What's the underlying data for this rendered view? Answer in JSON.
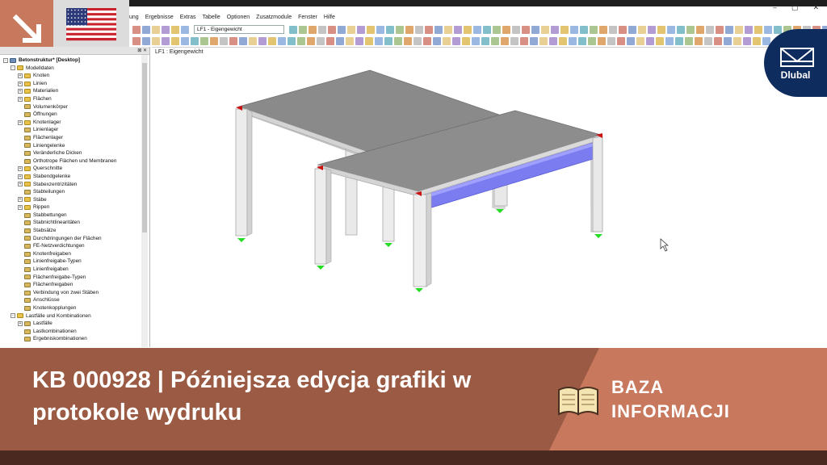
{
  "window": {
    "menu": [
      "ung",
      "Ergebnisse",
      "Extras",
      "Tabelle",
      "Optionen",
      "Zusatzmodule",
      "Fenster",
      "Hilfe"
    ],
    "controls": [
      "–",
      "▢",
      "✕"
    ]
  },
  "toolbar": {
    "loadcase_combo": "LF1 - Eigengewicht"
  },
  "navigator": {
    "root": "Betonstruktur* [Desktop]",
    "items": [
      {
        "label": "Modelldaten",
        "level": 1,
        "expander": "-",
        "icon": "fold"
      },
      {
        "label": "Knoten",
        "level": 2,
        "expander": "+",
        "icon": "fold"
      },
      {
        "label": "Linien",
        "level": 2,
        "expander": "+",
        "icon": "fold"
      },
      {
        "label": "Materialien",
        "level": 2,
        "expander": "+",
        "icon": "fold"
      },
      {
        "label": "Flächen",
        "level": 2,
        "expander": "+",
        "icon": "fold"
      },
      {
        "label": "Volumenkörper",
        "level": 2,
        "expander": "",
        "icon": "item"
      },
      {
        "label": "Öffnungen",
        "level": 2,
        "expander": "",
        "icon": "item"
      },
      {
        "label": "Knotenlager",
        "level": 2,
        "expander": "+",
        "icon": "fold"
      },
      {
        "label": "Linienlager",
        "level": 2,
        "expander": "",
        "icon": "item"
      },
      {
        "label": "Flächenlager",
        "level": 2,
        "expander": "",
        "icon": "item"
      },
      {
        "label": "Liniengelenke",
        "level": 2,
        "expander": "",
        "icon": "item"
      },
      {
        "label": "Veränderliche Dicken",
        "level": 2,
        "expander": "",
        "icon": "item"
      },
      {
        "label": "Orthotrope Flächen und Membranen",
        "level": 2,
        "expander": "",
        "icon": "item"
      },
      {
        "label": "Querschnitte",
        "level": 2,
        "expander": "+",
        "icon": "fold"
      },
      {
        "label": "Stabendgelenke",
        "level": 2,
        "expander": "+",
        "icon": "fold"
      },
      {
        "label": "Stabexzentrizitäten",
        "level": 2,
        "expander": "+",
        "icon": "fold"
      },
      {
        "label": "Stabteilungen",
        "level": 2,
        "expander": "",
        "icon": "item"
      },
      {
        "label": "Stäbe",
        "level": 2,
        "expander": "+",
        "icon": "fold"
      },
      {
        "label": "Rippen",
        "level": 2,
        "expander": "+",
        "icon": "fold"
      },
      {
        "label": "Stabbettungen",
        "level": 2,
        "expander": "",
        "icon": "item"
      },
      {
        "label": "Stabnichtlinearitäten",
        "level": 2,
        "expander": "",
        "icon": "item"
      },
      {
        "label": "Stabsätze",
        "level": 2,
        "expander": "",
        "icon": "item"
      },
      {
        "label": "Durchdringungen der Flächen",
        "level": 2,
        "expander": "",
        "icon": "item"
      },
      {
        "label": "FE-Netzverdichtungen",
        "level": 2,
        "expander": "",
        "icon": "item"
      },
      {
        "label": "Knotenfreigaben",
        "level": 2,
        "expander": "",
        "icon": "item"
      },
      {
        "label": "Linienfreigabe-Typen",
        "level": 2,
        "expander": "",
        "icon": "item"
      },
      {
        "label": "Linienfreigaben",
        "level": 2,
        "expander": "",
        "icon": "item"
      },
      {
        "label": "Flächenfreigabe-Typen",
        "level": 2,
        "expander": "",
        "icon": "item"
      },
      {
        "label": "Flächenfreigaben",
        "level": 2,
        "expander": "",
        "icon": "item"
      },
      {
        "label": "Verbindung von zwei Stäben",
        "level": 2,
        "expander": "",
        "icon": "item"
      },
      {
        "label": "Anschlüsse",
        "level": 2,
        "expander": "",
        "icon": "item"
      },
      {
        "label": "Knotenkopplungen",
        "level": 2,
        "expander": "",
        "icon": "item"
      },
      {
        "label": "Lastfälle und Kombinationen",
        "level": 1,
        "expander": "-",
        "icon": "fold"
      },
      {
        "label": "Lastfälle",
        "level": 2,
        "expander": "+",
        "icon": "item"
      },
      {
        "label": "Lastkombinationen",
        "level": 2,
        "expander": "",
        "icon": "item"
      },
      {
        "label": "Ergebniskombinationen",
        "level": 2,
        "expander": "",
        "icon": "item"
      }
    ]
  },
  "viewport": {
    "label": "LF1 : Eigengewicht"
  },
  "banner": {
    "title": "KB 000928 | Późniejsza edycja grafiki w protokole wydruku",
    "section_label": "BAZA\nINFORMACJI"
  },
  "logo": {
    "text": "Dlubal"
  },
  "colors": {
    "banner": "#9b5a43",
    "banner_accent": "#c8785d",
    "logo_bg": "#0f2c5e",
    "beam": "#7b7cf0",
    "support": "#22dd22",
    "hinge": "#cc1111"
  }
}
